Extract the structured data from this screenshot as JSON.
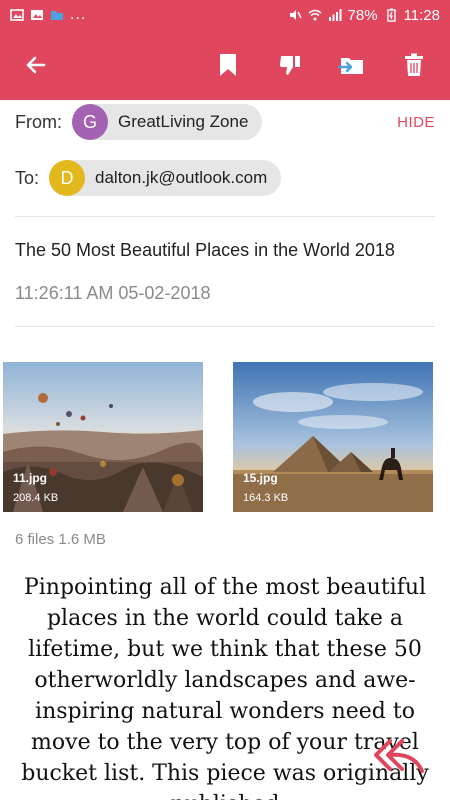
{
  "status_bar": {
    "battery": "78%",
    "time": "11:28",
    "overflow": "..."
  },
  "toolbar": {
    "icons": [
      "back-arrow-icon",
      "bookmark-icon",
      "thumbs-down-icon",
      "move-to-folder-icon",
      "trash-icon"
    ]
  },
  "header": {
    "from_label": "From:",
    "sender_initial": "G",
    "sender_name": "GreatLiving Zone",
    "hide_label": "HIDE",
    "to_label": "To:",
    "recipient_initial": "D",
    "recipient_email": "dalton.jk@outlook.com"
  },
  "message": {
    "subject": "The 50 Most Beautiful Places in the World 2018",
    "datetime": "11:26:11 AM 05-02-2018"
  },
  "attachments": {
    "items": [
      {
        "name": "11.jpg",
        "size": "208.4 KB"
      },
      {
        "name": "15.jpg",
        "size": "164.3 KB"
      }
    ],
    "summary": "6 files 1.6 MB"
  },
  "body": {
    "text": "Pinpointing all of the most beautiful places in the world could take a lifetime, but we think that these 50 otherworldly landscapes and awe-inspiring natural wonders need to move to the very top of your travel bucket list. This piece was originally published"
  },
  "colors": {
    "accent": "#e0475e",
    "sender_avatar": "#a462b3",
    "recipient_avatar": "#e2b81c"
  }
}
